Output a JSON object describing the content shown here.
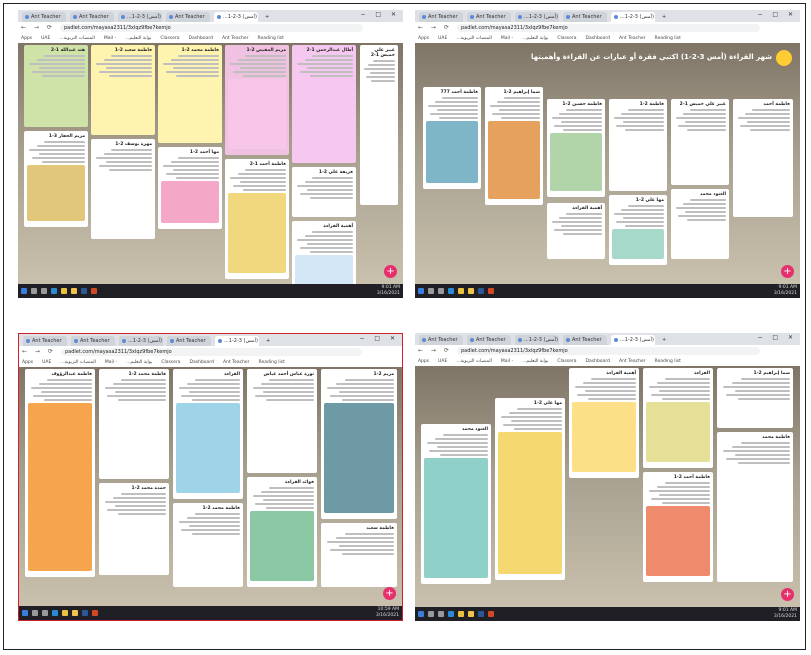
{
  "panels": [
    {
      "id": "top-left",
      "tabs": [
        "Ant Teacher",
        "Ant Teacher",
        "...شهر القراءة (أمس) 3-2-1",
        "Ant Teacher",
        "...شهر القراءة (أمس) 3-2-1"
      ],
      "url": "padlet.com/mayasa2311/3xlqz9fbe7kemjo",
      "bookmarks": [
        "Apps",
        "UAE",
        "...المنصات التربوية",
        "Mail -",
        "...بوابة التعليم",
        "Classera",
        "Dashboard",
        "Ant Teacher",
        "Reading list"
      ],
      "clock": {
        "time": "9:01 AM",
        "date": "3/16/2021"
      },
      "cards": [
        {
          "title": "هند عبدالله 1-2",
          "color": "#cfe2a8"
        },
        {
          "title": "فاطمة سعيد 2-1",
          "color": "#fff3b0"
        },
        {
          "title": "فاطمة محمد 2-1",
          "color": "#fff3b0"
        },
        {
          "title": "مريم المقيص 2-1",
          "color": "#f1c1e2"
        },
        {
          "title": "أطال عبدالرحمن 1-2",
          "color": "#f6c8ef"
        },
        {
          "title": "مريم الحفار 3-1",
          "color": "#fff"
        },
        {
          "title": "مهرة يوسف 2-1",
          "color": "#fff"
        },
        {
          "title": "مها أحمد 2-1",
          "color": "#fff"
        },
        {
          "title": "فاطمة أحمد 1-2",
          "color": "#fff"
        },
        {
          "title": "فريقة علي 2-1",
          "color": "#fff"
        },
        {
          "title": "أهمية القراءة",
          "color": "#fff"
        },
        {
          "title": "عبير علي خميس 1-2",
          "color": "#fff"
        }
      ]
    },
    {
      "id": "top-right",
      "tabs": [
        "Ant Teacher",
        "Ant Teacher",
        "...شهر القراءة (أمس) 3-2-1",
        "Ant Teacher",
        "...شهر القراءة (أمس) 3-2-1"
      ],
      "url": "padlet.com/mayasa2311/3xlqz9fbe7kemjo",
      "bookmarks": [
        "Apps",
        "UAE",
        "...المنصات التربوية",
        "Mail -",
        "...بوابة التعليم",
        "Classera",
        "Dashboard",
        "Ant Teacher",
        "Reading list"
      ],
      "clock": {
        "time": "9:01 AM",
        "date": "3/16/2021"
      },
      "board_title": "شهر القراءة (أمس 3-2-1) اكتبي فقرة أو عبارات عن القراءة وأهميتها",
      "cards": [
        {
          "title": "فاطمة أحمد 777",
          "color": "#fff"
        },
        {
          "title": "شما إبراهيم 2-1",
          "color": "#fff"
        },
        {
          "title": "فاطمة حسين 2-1",
          "color": "#fff"
        },
        {
          "title": "فاطمة 2-1",
          "color": "#fff"
        },
        {
          "title": "عبير علي خميس 1-2",
          "color": "#fff"
        },
        {
          "title": "أهمية القراءة",
          "color": "#fff"
        },
        {
          "title": "العنود محمد",
          "color": "#fff"
        },
        {
          "title": "مها علي 2-1",
          "color": "#fff"
        },
        {
          "title": "فاطمة أحمد",
          "color": "#fff"
        }
      ]
    },
    {
      "id": "bottom-left",
      "tabs": [
        "Ant Teacher",
        "Ant Teacher",
        "...شهر القراءة (أمس) 3-2-1",
        "Ant Teacher",
        "...شهر القراءة (أمس) 3-2-1"
      ],
      "url": "padlet.com/mayasa2311/3xlqz9fbe7kemjo",
      "bookmarks": [
        "Apps",
        "UAE",
        "...المنصات التربوية",
        "Mail -",
        "...بوابة التعليم",
        "Classera",
        "Dashboard",
        "Ant Teacher",
        "Reading list"
      ],
      "clock": {
        "time": "10:59 AM",
        "date": "3/16/2021"
      },
      "cards": [
        {
          "title": "فاطمة عبدالرؤوف",
          "color": "#fff"
        },
        {
          "title": "فاطمة محمد 2-1",
          "color": "#fff"
        },
        {
          "title": "القراءة",
          "color": "#fff"
        },
        {
          "title": "نورة عباس أحمد عباس",
          "color": "#fff"
        },
        {
          "title": "مريم 2-1",
          "color": "#fff"
        },
        {
          "title": "فوائد القراءة",
          "color": "#fff"
        },
        {
          "title": "حمدة محمد 2-1",
          "color": "#fff"
        },
        {
          "title": "فاطمة محمد 2-1",
          "color": "#fff"
        },
        {
          "title": "فاطمة سعيد",
          "color": "#fff"
        }
      ]
    },
    {
      "id": "bottom-right",
      "tabs": [
        "Ant Teacher",
        "Ant Teacher",
        "...شهر القراءة (أمس) 3-2-1",
        "Ant Teacher",
        "...شهر القراءة (أمس) 3-2-1"
      ],
      "url": "padlet.com/mayasa2311/3xlqz9fbe7kemjo",
      "bookmarks": [
        "Apps",
        "UAE",
        "...المنصات التربوية",
        "Mail -",
        "...بوابة التعليم",
        "Classera",
        "Dashboard",
        "Ant Teacher",
        "Reading list"
      ],
      "clock": {
        "time": "9:01 AM",
        "date": "3/16/2021"
      },
      "cards": [
        {
          "title": "العنود محمد",
          "color": "#fff"
        },
        {
          "title": "مها علي 2-1",
          "color": "#fff"
        },
        {
          "title": "أهمية القراءة",
          "color": "#fff"
        },
        {
          "title": "القراءة",
          "color": "#fff"
        },
        {
          "title": "فاطمة أحمد 2-1",
          "color": "#fff"
        },
        {
          "title": "شما إبراهيم 2-1",
          "color": "#fff"
        },
        {
          "title": "فاطمة محمد",
          "color": "#fff"
        }
      ]
    }
  ],
  "icons": {
    "taskbar": [
      "windows-icon",
      "search-icon",
      "task-view-icon",
      "edge-icon",
      "chrome-icon",
      "explorer-icon",
      "word-icon",
      "powerpoint-icon"
    ],
    "fab": "plus-icon"
  },
  "colors": {
    "fab": "#e72f6e",
    "taskbar": "#1f1f25",
    "highlight_border": "#d0202a"
  },
  "fab_label": "+"
}
